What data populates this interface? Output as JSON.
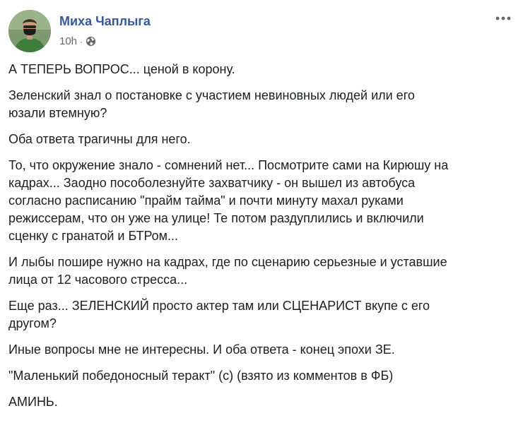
{
  "post": {
    "author_name": "Миха Чаплыга",
    "timestamp": "10h",
    "separator": "·",
    "privacy_icon": "globe-icon",
    "more_icon": "more-options-icon",
    "link_color": "#385898",
    "meta_color": "#606770",
    "text_color": "#1c1e21",
    "paragraphs": [
      "А ТЕПЕРЬ ВОПРОС... ценой в корону.",
      "Зеленский знал о постановке с участием невиновных людей или его\nюзали втемную?",
      "Оба ответа трагичны для него.",
      "То, что окружение знало - сомнений нет... Посмотрите сами на Кирюшу на\nкадрах... Заодно пособолезнуйте захватчику - он вышел из автобуса\nсогласно расписанию \"прайм тайма\" и почти минуту махал руками\nрежиссерам, что он уже на улице! Те потом раздуплились и включили\nсценку с гранатой и БТРом...",
      "И лыбы пошире нужно на кадрах, где по сценарию серьезные и уставшие\nлица от 12 часового стресса...",
      "Еще раз... ЗЕЛЕНСКИЙ просто актер там или СЦЕНАРИСТ вкупе с его\nдругом?",
      "Иные вопросы мне не интересны. И оба ответа - конец эпохи ЗЕ.",
      "\"Маленький победоносный теракт\" (с) (взято из комментов в ФБ)",
      "АМИНЬ."
    ]
  }
}
